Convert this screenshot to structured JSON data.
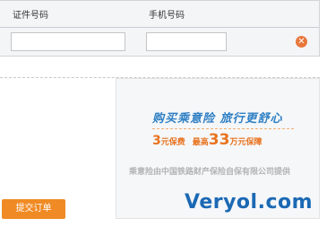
{
  "form": {
    "id_number_header": "证件号码",
    "phone_header": "手机号码",
    "id_number_value": "",
    "phone_value": "",
    "remove_icon": "close-circle-icon"
  },
  "banner": {
    "slogan": "购买乘意险  旅行更舒心",
    "price_prefix_num": "3",
    "price_prefix_text": "元保费",
    "max_label": "最高",
    "max_num": "33",
    "max_text": "万元保障",
    "provider": "乘意险由中国铁路财产保险自保有限公司提供",
    "watermark": "Veryol.com"
  },
  "submit_label": "提交订单",
  "colors": {
    "accent_orange": "#f08a24",
    "slogan_blue": "#2e7fc4",
    "price_orange": "#e8731f",
    "watermark_blue": "#1b69b4"
  }
}
